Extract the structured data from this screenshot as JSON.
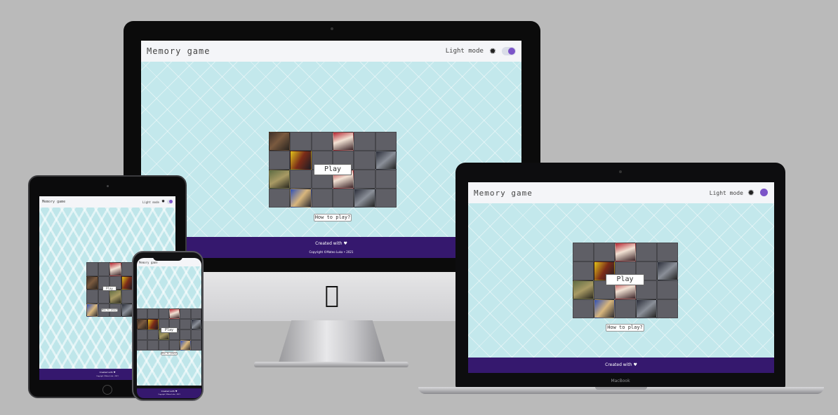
{
  "app": {
    "brand": "Memory game",
    "mode_label": "Light mode",
    "mode_icon": "gear-icon",
    "toggle_on": true,
    "play_label": "Play",
    "howto_label": "How to play?",
    "footer_created": "Created with ♥",
    "footer_copyright": "Copyright ©Mateo Luka • 2021"
  },
  "devices": {
    "laptop_label": "MacBook"
  },
  "colors": {
    "background": "#bababa",
    "page_pattern": "#c3e8ec",
    "navbar": "#f4f5f8",
    "footer": "#35186e",
    "toggle_knob": "#7b54c8",
    "board": "#5d5d63"
  }
}
